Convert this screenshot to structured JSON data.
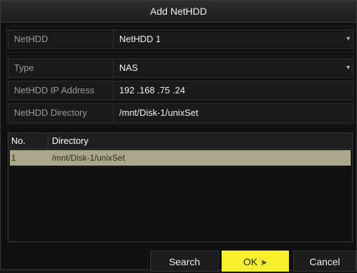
{
  "dialog": {
    "title": "Add NetHDD"
  },
  "fields": {
    "nethdd": {
      "label": "NetHDD",
      "value": "NetHDD 1"
    },
    "type": {
      "label": "Type",
      "value": "NAS"
    },
    "ip": {
      "label": "NetHDD IP Address",
      "value": "192 .168 .75  .24"
    },
    "directory": {
      "label": "NetHDD Directory",
      "value": "/mnt/Disk-1/unixSet"
    }
  },
  "table": {
    "headers": {
      "no": "No.",
      "directory": "Directory"
    },
    "rows": [
      {
        "no": "1",
        "directory": "/mnt/Disk-1/unixSet"
      }
    ]
  },
  "buttons": {
    "search": "Search",
    "ok": "OK",
    "cancel": "Cancel"
  },
  "colors": {
    "selected_row": "#aaa78a",
    "ok_button": "#f7ef2c"
  }
}
